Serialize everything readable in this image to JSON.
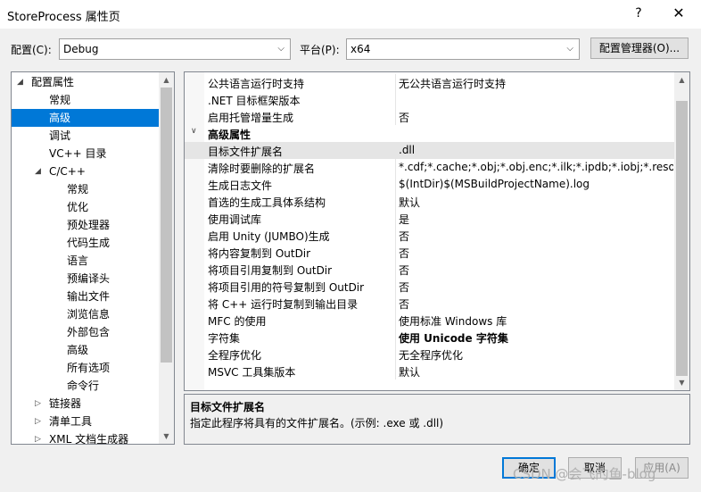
{
  "window": {
    "title": "StoreProcess 属性页",
    "help_label": "?",
    "close_label": "✕"
  },
  "config": {
    "config_label": "配置(C):",
    "config_value": "Debug",
    "platform_label": "平台(P):",
    "platform_value": "x64",
    "manager_label": "配置管理器(O)..."
  },
  "tree": [
    {
      "label": "配置属性",
      "level": 0,
      "expanded": true
    },
    {
      "label": "常规",
      "level": 1
    },
    {
      "label": "高级",
      "level": 1,
      "selected": true
    },
    {
      "label": "调试",
      "level": 1
    },
    {
      "label": "VC++ 目录",
      "level": 1
    },
    {
      "label": "C/C++",
      "level": 1,
      "expanded": true
    },
    {
      "label": "常规",
      "level": 2
    },
    {
      "label": "优化",
      "level": 2
    },
    {
      "label": "预处理器",
      "level": 2
    },
    {
      "label": "代码生成",
      "level": 2
    },
    {
      "label": "语言",
      "level": 2
    },
    {
      "label": "预编译头",
      "level": 2
    },
    {
      "label": "输出文件",
      "level": 2
    },
    {
      "label": "浏览信息",
      "level": 2
    },
    {
      "label": "外部包含",
      "level": 2
    },
    {
      "label": "高级",
      "level": 2
    },
    {
      "label": "所有选项",
      "level": 2
    },
    {
      "label": "命令行",
      "level": 2
    },
    {
      "label": "链接器",
      "level": 1,
      "collapsed": true
    },
    {
      "label": "清单工具",
      "level": 1,
      "collapsed": true
    },
    {
      "label": "XML 文档生成器",
      "level": 1,
      "collapsed": true
    }
  ],
  "grid": [
    {
      "name": "公共语言运行时支持",
      "value": "无公共语言运行时支持"
    },
    {
      "name": ".NET 目标框架版本",
      "value": ""
    },
    {
      "name": "启用托管增量生成",
      "value": "否"
    },
    {
      "name": "高级属性",
      "value": "",
      "category": true
    },
    {
      "name": "目标文件扩展名",
      "value": ".dll",
      "selected": true
    },
    {
      "name": "清除时要删除的扩展名",
      "value": "*.cdf;*.cache;*.obj;*.obj.enc;*.ilk;*.ipdb;*.iobj;*.resources;*.tlb;*.tli;*.tlh;*.tmp;*.rsp;*.pgc;*.pgd;*.meta;*.tlog;*.manifest;*.res;*.pch;*.exp;*.idb;*.rep;*.xdc;*.pdb;*_manifest.rc;*.bsc;*.sbr;*.xml;*.metagen;*.bi"
    },
    {
      "name": "生成日志文件",
      "value": "$(IntDir)$(MSBuildProjectName).log"
    },
    {
      "name": "首选的生成工具体系结构",
      "value": "默认"
    },
    {
      "name": "使用调试库",
      "value": "是"
    },
    {
      "name": "启用 Unity (JUMBO)生成",
      "value": "否"
    },
    {
      "name": "将内容复制到 OutDir",
      "value": "否"
    },
    {
      "name": "将项目引用复制到 OutDir",
      "value": "否"
    },
    {
      "name": "将项目引用的符号复制到 OutDir",
      "value": "否"
    },
    {
      "name": "将 C++ 运行时复制到输出目录",
      "value": "否"
    },
    {
      "name": "MFC 的使用",
      "value": "使用标准 Windows 库"
    },
    {
      "name": "字符集",
      "value": "使用 Unicode 字符集",
      "bold": true
    },
    {
      "name": "全程序优化",
      "value": "无全程序优化"
    },
    {
      "name": "MSVC 工具集版本",
      "value": "默认"
    }
  ],
  "description": {
    "title": "目标文件扩展名",
    "text": "指定此程序将具有的文件扩展名。(示例: .exe 或 .dll)"
  },
  "buttons": {
    "ok": "确定",
    "cancel": "取消",
    "apply": "应用(A)"
  },
  "watermark": "CSDN @会飞的鱼-blog"
}
